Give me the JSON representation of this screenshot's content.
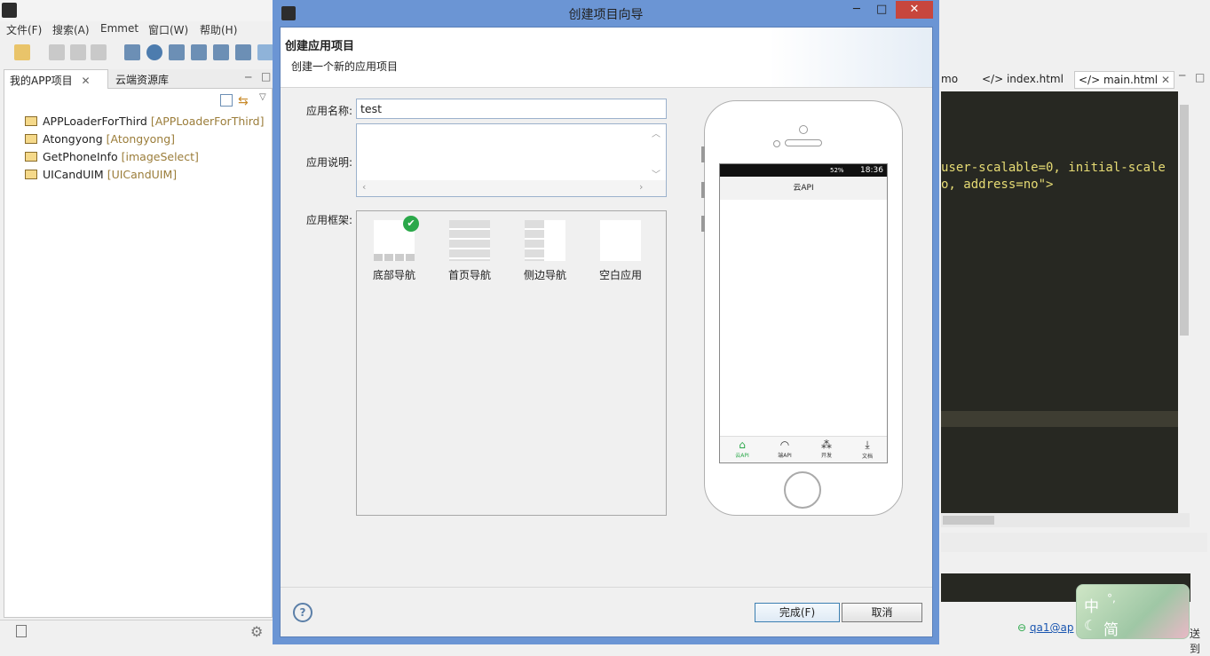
{
  "ide": {
    "menu": [
      "文件(F)",
      "搜索(A)",
      "Emmet",
      "窗口(W)",
      "帮助(H)"
    ],
    "left_tabs": [
      "我的APP项目",
      "云端资源库"
    ],
    "projects": [
      {
        "name": "APPLoaderForThird",
        "tag": "[APPLoaderForThird]"
      },
      {
        "name": "Atongyong",
        "tag": "[Atongyong]"
      },
      {
        "name": "GetPhoneInfo",
        "tag": "[imageSelect]"
      },
      {
        "name": "UICandUIM",
        "tag": "[UICandUIM]"
      }
    ],
    "editor_tabs": [
      "mo",
      "index.html",
      "main.html"
    ],
    "code_lines": [
      "user-scalable=0, initial-scale",
      "o, address=no\">"
    ],
    "status_user": "qa1@ap",
    "status_tail": "送到"
  },
  "dialog": {
    "title": "创建项目向导",
    "header_title": "创建应用项目",
    "header_subtitle": "创建一个新的应用项目",
    "name_label": "应用名称:",
    "name_value": "test",
    "desc_label": "应用说明:",
    "desc_value": "",
    "framework_label": "应用框架:",
    "frameworks": [
      "底部导航",
      "首页导航",
      "侧边导航",
      "空白应用"
    ],
    "selected_framework": "底部导航",
    "help_label": "?",
    "finish_label": "完成(F)",
    "cancel_label": "取消"
  },
  "phone": {
    "status_text": "52%",
    "time": "18:36",
    "app_title": "云API",
    "nav_items": [
      "云API",
      "端API",
      "开发",
      "文档"
    ]
  },
  "ime": {
    "mode": "中",
    "char": "简",
    "punct": "°,"
  },
  "colors": {
    "dialog_frame": "#6b95d4",
    "close_red": "#c7463d",
    "check_green": "#2ba84a"
  }
}
